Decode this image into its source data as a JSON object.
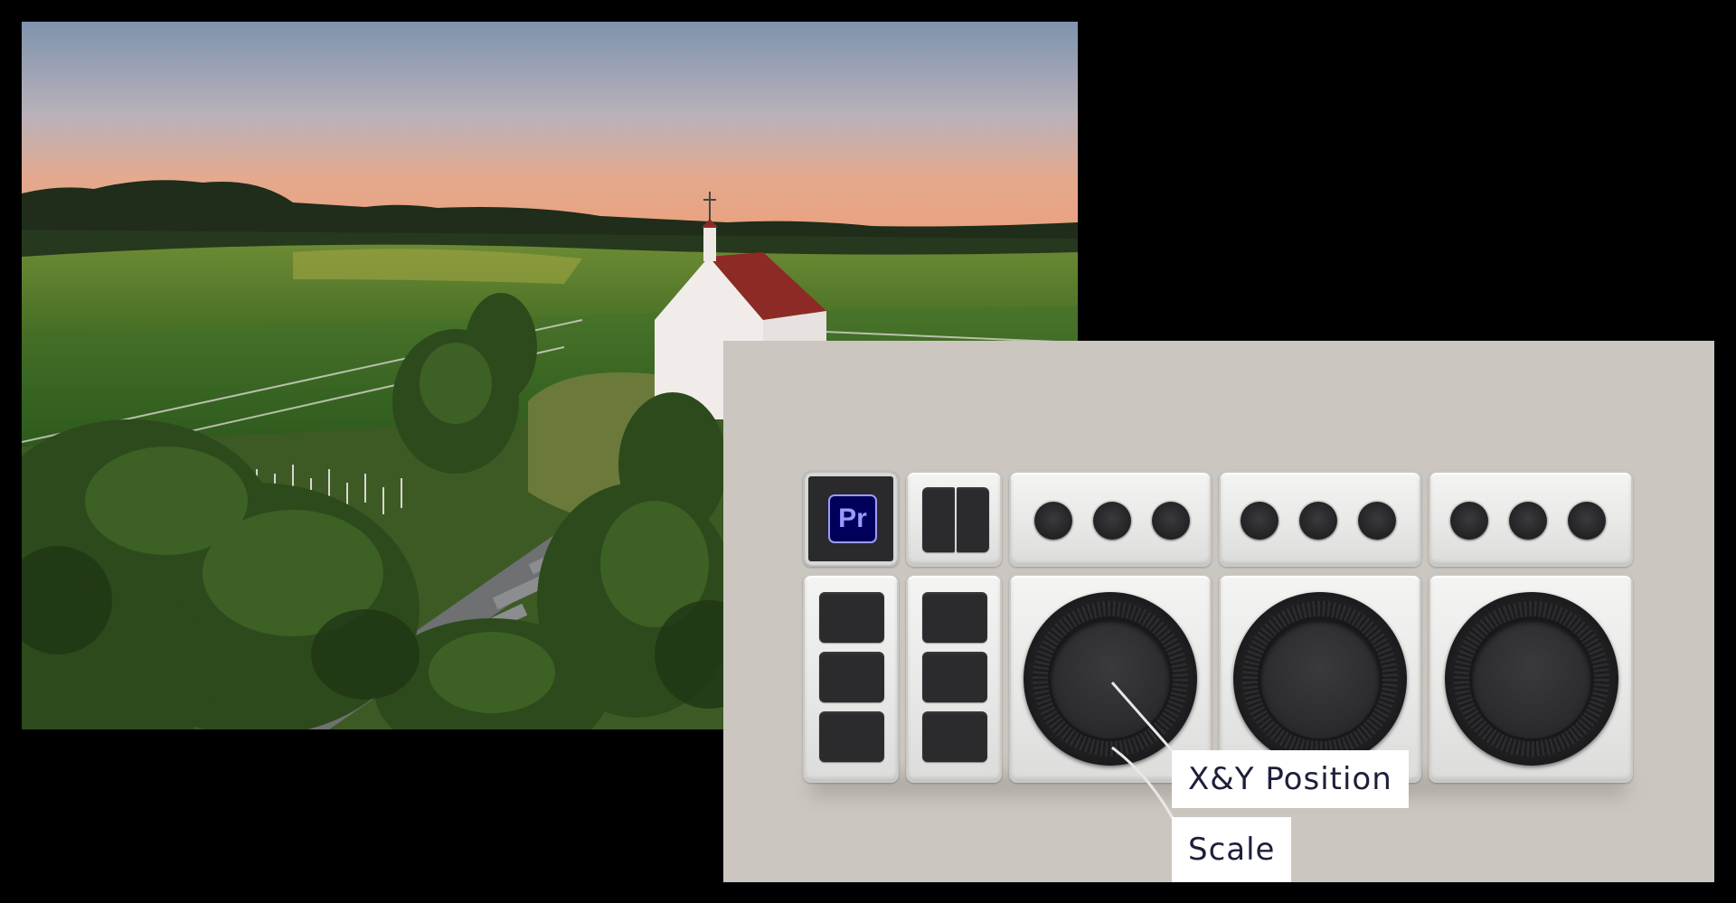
{
  "controller": {
    "app_badge": "Pr",
    "accent_color": "#9999ff",
    "badge_bg": "#00005b"
  },
  "labels": {
    "position": "X&Y Position",
    "scale": "Scale"
  }
}
